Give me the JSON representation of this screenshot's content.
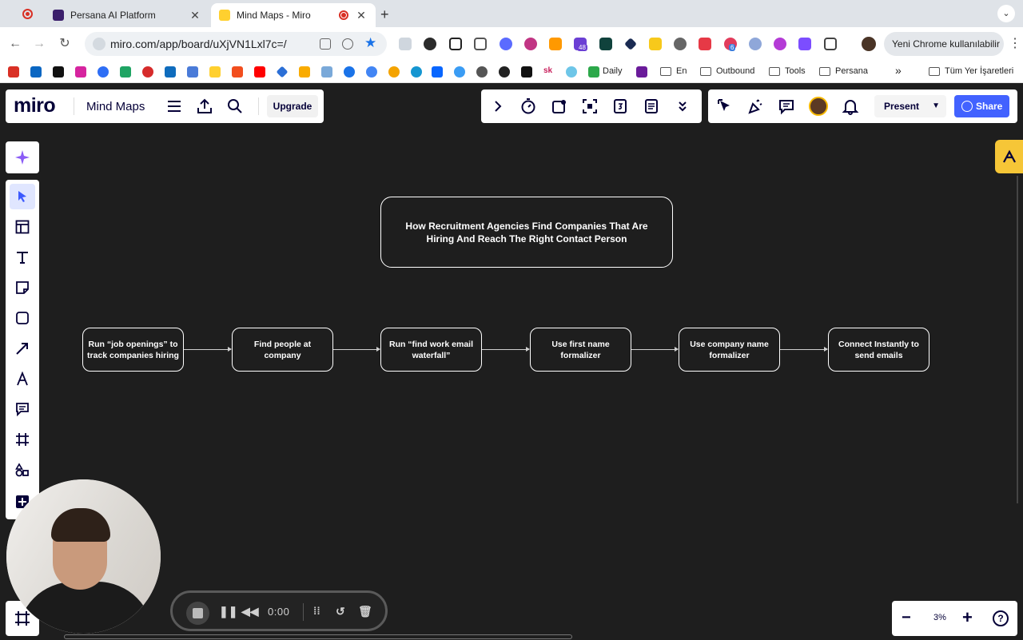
{
  "browser": {
    "tabs": [
      {
        "title": "Persana AI Platform",
        "active": false
      },
      {
        "title": "Mind Maps - Miro",
        "active": true
      }
    ],
    "url": "miro.com/app/board/uXjVN1Lxl7c=/",
    "profile_label": "Yeni Chrome kullanılabilir",
    "extension_badges": {
      "badge_a": "48",
      "badge_b": "6"
    },
    "bookmarks": [
      {
        "label": "Daily",
        "type": "link"
      },
      {
        "label": "En",
        "type": "folder"
      },
      {
        "label": "Outbound",
        "type": "folder"
      },
      {
        "label": "Tools",
        "type": "folder"
      },
      {
        "label": "Persana",
        "type": "folder"
      }
    ],
    "bookmarks_overflow": "»",
    "all_bookmarks_label": "Tüm Yer İşaretleri"
  },
  "miro": {
    "logo": "miro",
    "board_name": "Mind Maps",
    "upgrade_label": "Upgrade",
    "present_label": "Present",
    "share_label": "Share",
    "zoom_level": "3%",
    "accent_color": "#4262ff"
  },
  "board": {
    "title_node": "How Recruitment Agencies Find Companies That Are Hiring And Reach The Right Contact Person",
    "steps": [
      "Run “job openings” to track companies hiring",
      "Find people at company",
      "Run “find work email waterfall”",
      "Use first name formalizer",
      "Use company name formalizer",
      "Connect Instantly to send emails"
    ]
  },
  "recorder": {
    "time": "0:00"
  }
}
